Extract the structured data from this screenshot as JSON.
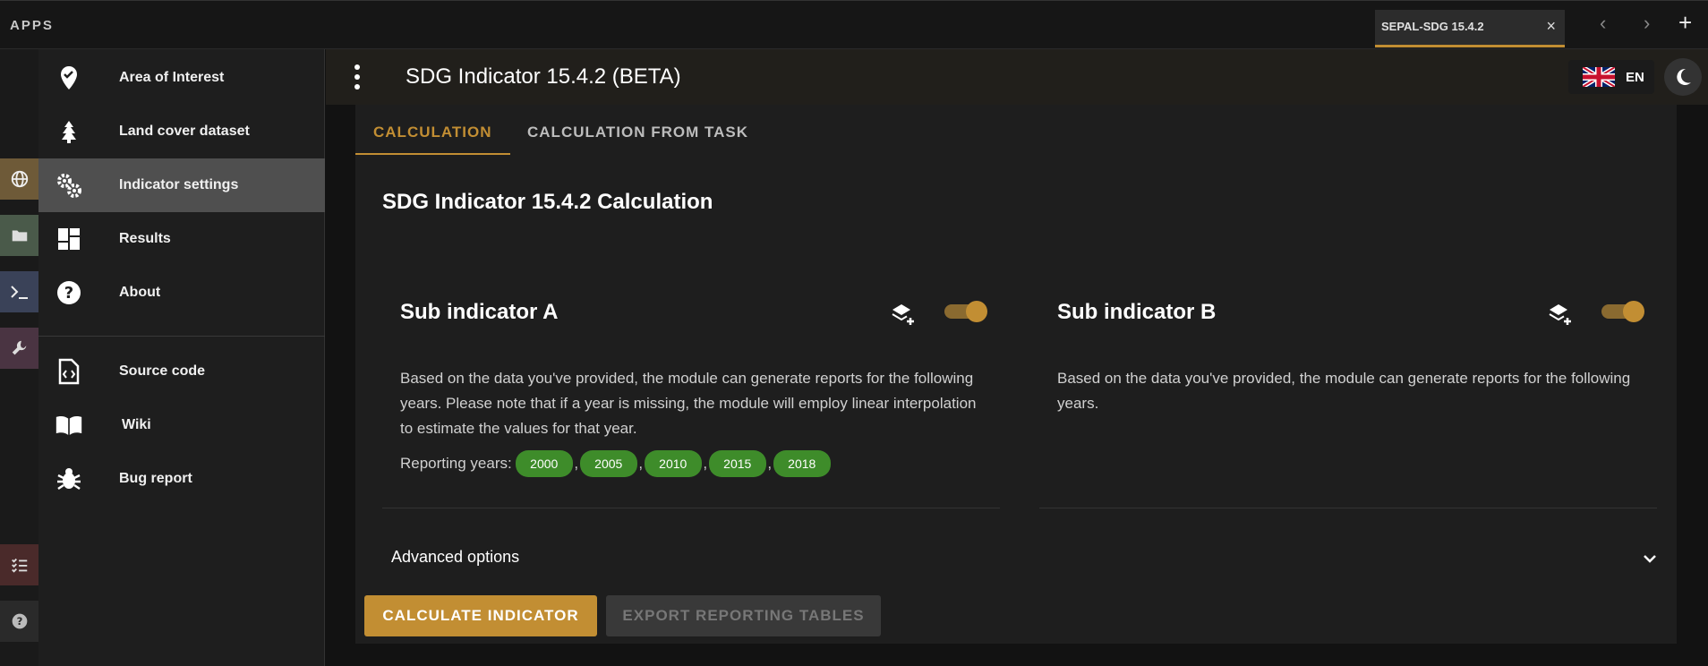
{
  "topbar": {
    "apps_label": "APPS",
    "tab_label": "SEPAL-SDG 15.4.2",
    "tab_close": "×",
    "back_arrow": "‹",
    "forward_arrow": "›",
    "add": "+"
  },
  "rail": {
    "items": [
      "globe-icon",
      "folder-icon",
      "terminal-icon",
      "wrench-icon",
      "checklist-icon",
      "help-icon"
    ]
  },
  "drawer": {
    "items": [
      {
        "label": "Area of Interest",
        "icon": "map-marker-check-icon"
      },
      {
        "label": "Land cover dataset",
        "icon": "pine-tree-icon"
      },
      {
        "label": "Indicator settings",
        "icon": "cogs-icon",
        "active": true
      },
      {
        "label": "Results",
        "icon": "dashboard-icon"
      },
      {
        "label": "About",
        "icon": "help-circle-icon"
      },
      {
        "label": "Source code",
        "icon": "file-code-icon"
      },
      {
        "label": "Wiki",
        "icon": "book-open-icon"
      },
      {
        "label": "Bug report",
        "icon": "bug-icon"
      }
    ]
  },
  "header": {
    "title": "SDG Indicator 15.4.2 (BETA)",
    "language": "EN"
  },
  "tabs": [
    "CALCULATION",
    "CALCULATION FROM TASK"
  ],
  "card": {
    "title": "SDG Indicator 15.4.2 Calculation"
  },
  "sub_a": {
    "title": "Sub indicator A",
    "description": "Based on the data you've provided, the module can generate reports for the following years. Please note that if a year is missing, the module will employ linear interpolation to estimate the values for that year.",
    "years_label": "Reporting years:",
    "years": [
      "2000",
      "2005",
      "2010",
      "2015",
      "2018"
    ],
    "separator": ","
  },
  "sub_b": {
    "title": "Sub indicator B",
    "description": "Based on the data you've provided, the module can generate reports for the following years."
  },
  "advanced": {
    "label": "Advanced options"
  },
  "buttons": {
    "calculate": "CALCULATE INDICATOR",
    "export": "EXPORT REPORTING TABLES"
  },
  "colors": {
    "accent": "#c28e33",
    "chip": "#3e8c2a",
    "active_item": "#4f4f4f"
  }
}
